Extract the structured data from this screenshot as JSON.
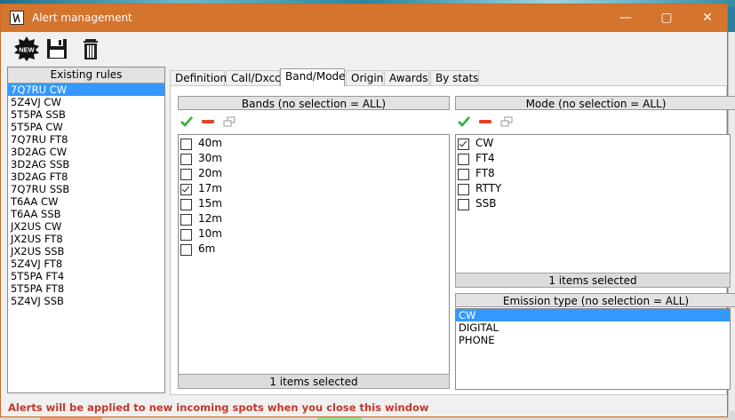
{
  "window": {
    "title": "Alert management"
  },
  "toolbar": {
    "new_label": "NEW",
    "icons": [
      "new-icon",
      "save-icon",
      "trash-icon"
    ]
  },
  "rules": {
    "header": "Existing rules",
    "items": [
      "7Q7RU CW",
      "5Z4VJ CW",
      "5T5PA SSB",
      "5T5PA CW",
      "7Q7RU FT8",
      "3D2AG CW",
      "3D2AG SSB",
      "3D2AG FT8",
      "7Q7RU SSB",
      "T6AA CW",
      "T6AA SSB",
      "JX2US CW",
      "JX2US FT8",
      "JX2US SSB",
      "5Z4VJ FT8",
      "5T5PA FT4",
      "5T5PA FT8",
      "5Z4VJ SSB"
    ],
    "selected_index": 0
  },
  "tabs": [
    "Definition",
    "Call/Dxcc",
    "Band/Mode",
    "Origin",
    "Awards",
    "By stats"
  ],
  "active_tab": 2,
  "bands": {
    "header": "Bands (no selection = ALL)",
    "items": [
      {
        "label": "40m",
        "checked": false
      },
      {
        "label": "30m",
        "checked": false
      },
      {
        "label": "20m",
        "checked": false
      },
      {
        "label": "17m",
        "checked": true
      },
      {
        "label": "15m",
        "checked": false
      },
      {
        "label": "12m",
        "checked": false
      },
      {
        "label": "10m",
        "checked": false
      },
      {
        "label": "6m",
        "checked": false
      }
    ],
    "status": "1 items selected"
  },
  "modes": {
    "header": "Mode (no selection = ALL)",
    "items": [
      {
        "label": "CW",
        "checked": true
      },
      {
        "label": "FT4",
        "checked": false
      },
      {
        "label": "FT8",
        "checked": false
      },
      {
        "label": "RTTY",
        "checked": false
      },
      {
        "label": "SSB",
        "checked": false
      }
    ],
    "status": "1 items selected"
  },
  "emission": {
    "header": "Emission type (no selection = ALL)",
    "items": [
      "CW",
      "DIGITAL",
      "PHONE"
    ],
    "selected_index": 0
  },
  "footer": {
    "message": "Alerts will be applied to new incoming spots when you close this window"
  },
  "colors": {
    "titlebar": "#d5742d",
    "selection": "#3399ff",
    "footer_text": "#c0392b",
    "check_green": "#3cb043",
    "minus_red": "#e0452b"
  }
}
